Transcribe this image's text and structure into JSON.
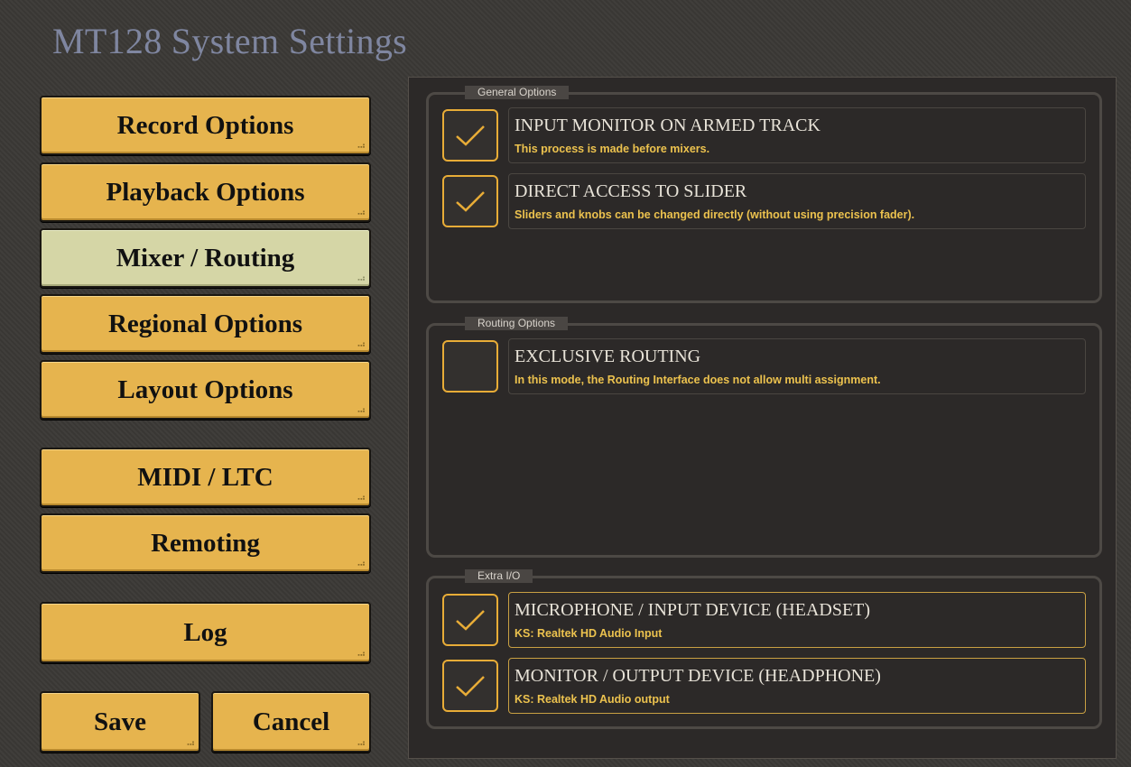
{
  "window": {
    "title": "MT128 System Settings"
  },
  "nav": {
    "items": [
      {
        "label": "Record Options"
      },
      {
        "label": "Playback Options"
      },
      {
        "label": "Mixer / Routing",
        "active": true
      },
      {
        "label": "Regional Options"
      },
      {
        "label": "Layout Options"
      },
      {
        "label": "MIDI / LTC"
      },
      {
        "label": "Remoting"
      },
      {
        "label": "Log"
      }
    ],
    "save_label": "Save",
    "cancel_label": "Cancel"
  },
  "groups": {
    "general": {
      "label": "General Options",
      "options": [
        {
          "title": "INPUT MONITOR ON ARMED TRACK",
          "desc": "This process is made before mixers.",
          "checked": true
        },
        {
          "title": "DIRECT ACCESS TO SLIDER",
          "desc": "Sliders and knobs can be changed directly (without using precision fader).",
          "checked": true
        }
      ]
    },
    "routing": {
      "label": "Routing Options",
      "options": [
        {
          "title": "EXCLUSIVE ROUTING",
          "desc": "In this mode, the Routing Interface does not allow multi assignment.",
          "checked": false
        }
      ]
    },
    "extra": {
      "label": "Extra I/O",
      "options": [
        {
          "title": "MICROPHONE / INPUT DEVICE (HEADSET)",
          "desc": "KS: Realtek HD Audio Input",
          "checked": true
        },
        {
          "title": "MONITOR / OUTPUT DEVICE (HEADPHONE)",
          "desc": "KS: Realtek HD Audio output",
          "checked": true
        }
      ]
    }
  },
  "colors": {
    "button": "#e6b44e",
    "button_active": "#d5d6a6",
    "accent": "#e8ac37",
    "desc_text": "#ecc24e",
    "title_text": "#7f86a0"
  },
  "icons": {
    "check": "checkmark-icon",
    "grip": "resize-grip-icon"
  }
}
